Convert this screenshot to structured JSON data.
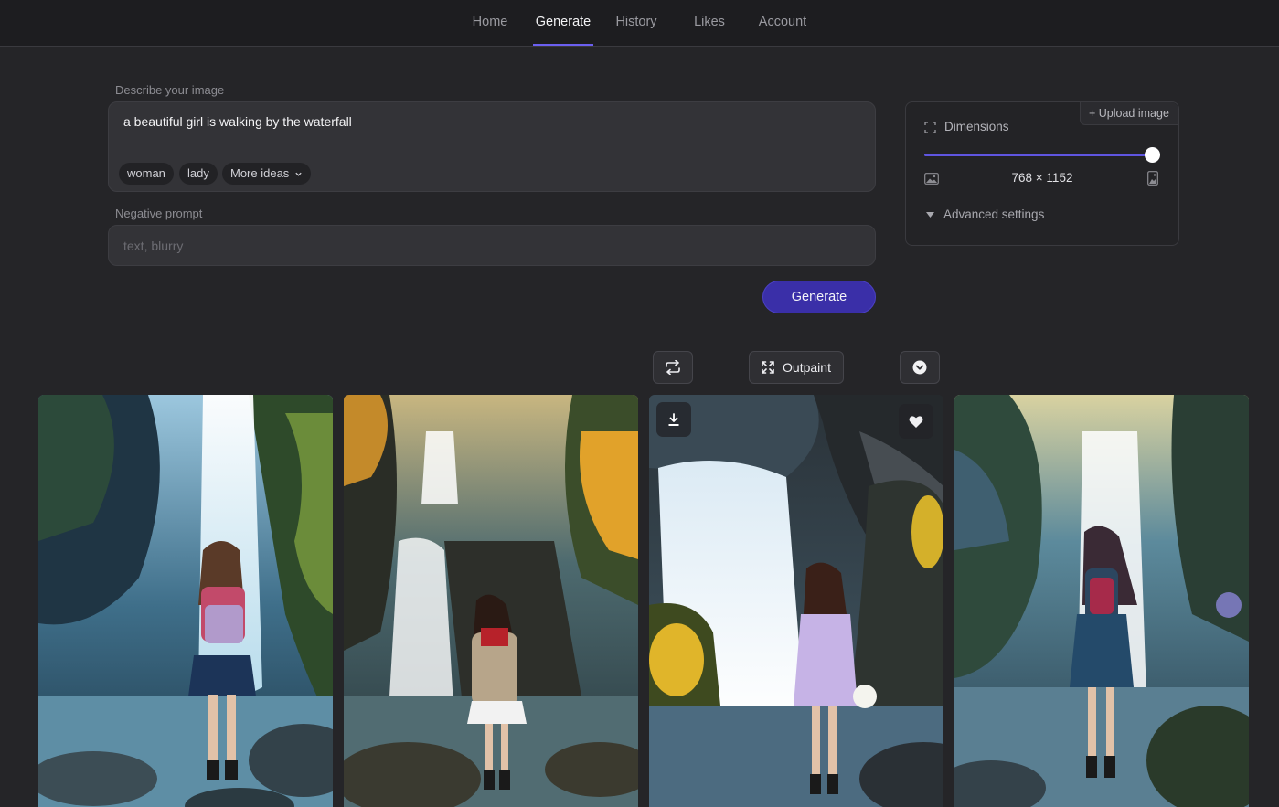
{
  "nav": {
    "items": [
      "Home",
      "Generate",
      "History",
      "Likes",
      "Account"
    ],
    "active": "Generate"
  },
  "prompt": {
    "label": "Describe your image",
    "value": "a beautiful girl is walking by the waterfall",
    "chips": [
      "woman",
      "lady",
      "More ideas"
    ]
  },
  "negative": {
    "label": "Negative prompt",
    "placeholder": "text, blurry"
  },
  "generate_label": "Generate",
  "dimensions": {
    "upload_label": "+ Upload image",
    "title": "Dimensions",
    "value": "768 × 1152",
    "slider_level": 1.0,
    "advanced_label": "Advanced settings"
  },
  "toolbar": {
    "outpaint_label": "Outpaint"
  },
  "images": [
    {
      "scene": "waterfall-girl-backpack"
    },
    {
      "scene": "waterfall-girl-jacket"
    },
    {
      "scene": "waterfall-girl-lilac-dress"
    },
    {
      "scene": "waterfall-girl-blue-dress"
    }
  ],
  "colors": {
    "accent": "#5f55e0",
    "generate_button": "#3a2fa8",
    "background": "#252528"
  }
}
